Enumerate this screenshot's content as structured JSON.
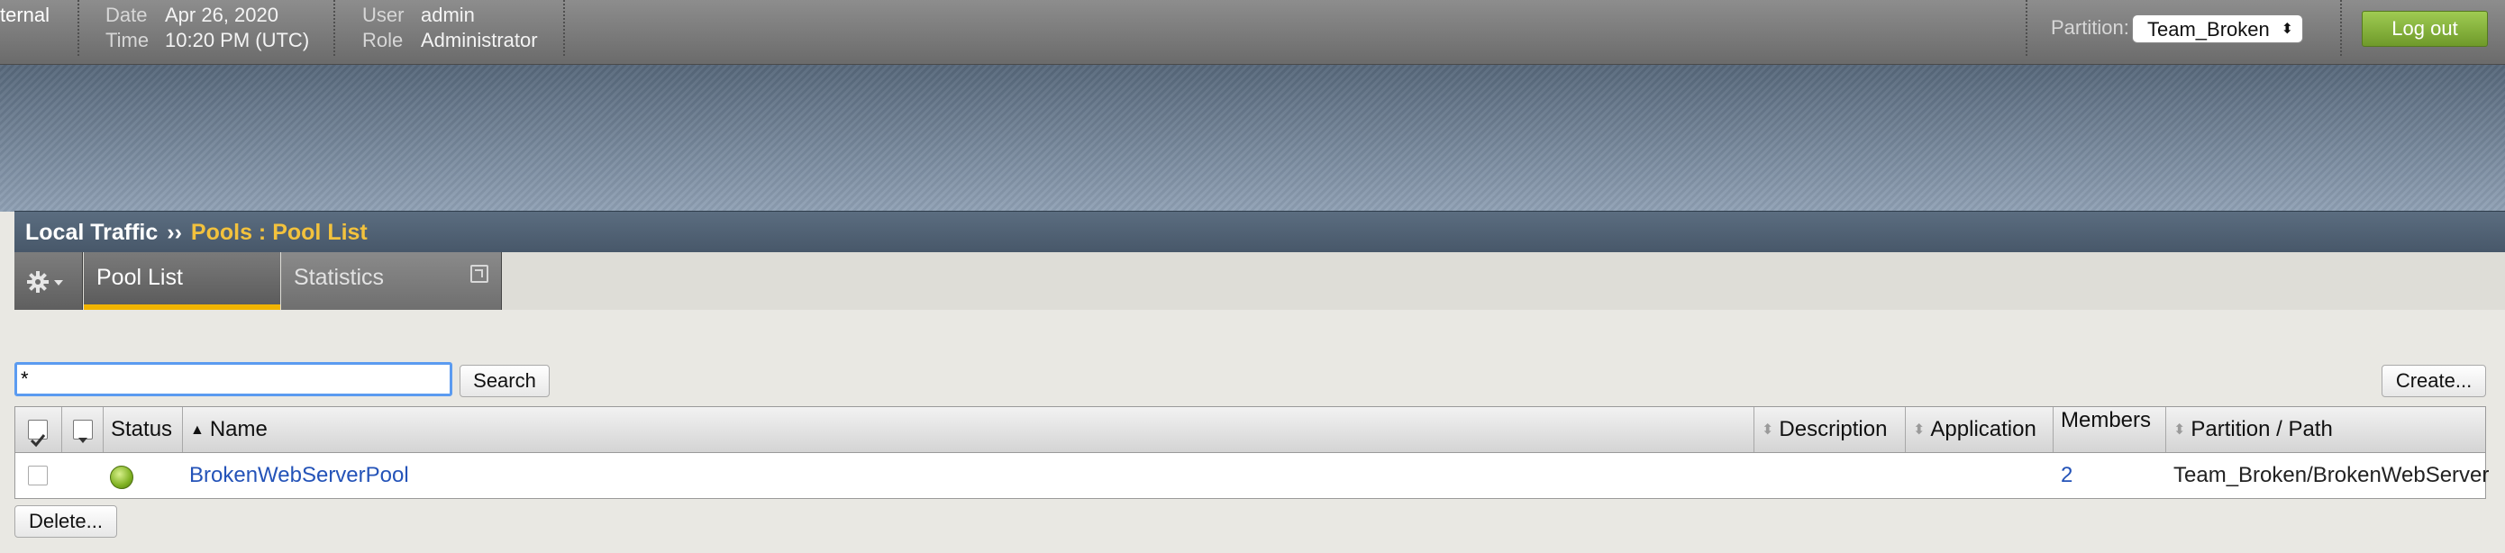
{
  "header": {
    "app_name_fragment": "ternal",
    "date_label": "Date",
    "date_value": "Apr 26, 2020",
    "time_label": "Time",
    "time_value": "10:20 PM (UTC)",
    "user_label": "User",
    "user_value": "admin",
    "role_label": "Role",
    "role_value": "Administrator",
    "partition_label": "Partition:",
    "partition_value": "Team_Broken",
    "logout_label": "Log out"
  },
  "breadcrumb": {
    "section": "Local Traffic",
    "separator": "››",
    "current": "Pools : Pool List"
  },
  "tabs": [
    {
      "label": "Pool List",
      "active": true
    },
    {
      "label": "Statistics",
      "active": false
    }
  ],
  "search": {
    "value": "*",
    "button_label": "Search"
  },
  "create_label": "Create...",
  "delete_label": "Delete...",
  "table": {
    "columns": [
      "Status",
      "Name",
      "Description",
      "Application",
      "Members",
      "Partition / Path"
    ],
    "rows": [
      {
        "status": "available",
        "name": "BrokenWebServerPool",
        "description": "",
        "application": "",
        "members": "2",
        "partition_path": "Team_Broken/BrokenWebServer"
      }
    ]
  },
  "colors": {
    "accent_tab": "#f1b400",
    "breadcrumb_current": "#f3c23d",
    "link": "#2453b8",
    "logout": "#8cbf3f",
    "status_ok": "#7fb122"
  }
}
